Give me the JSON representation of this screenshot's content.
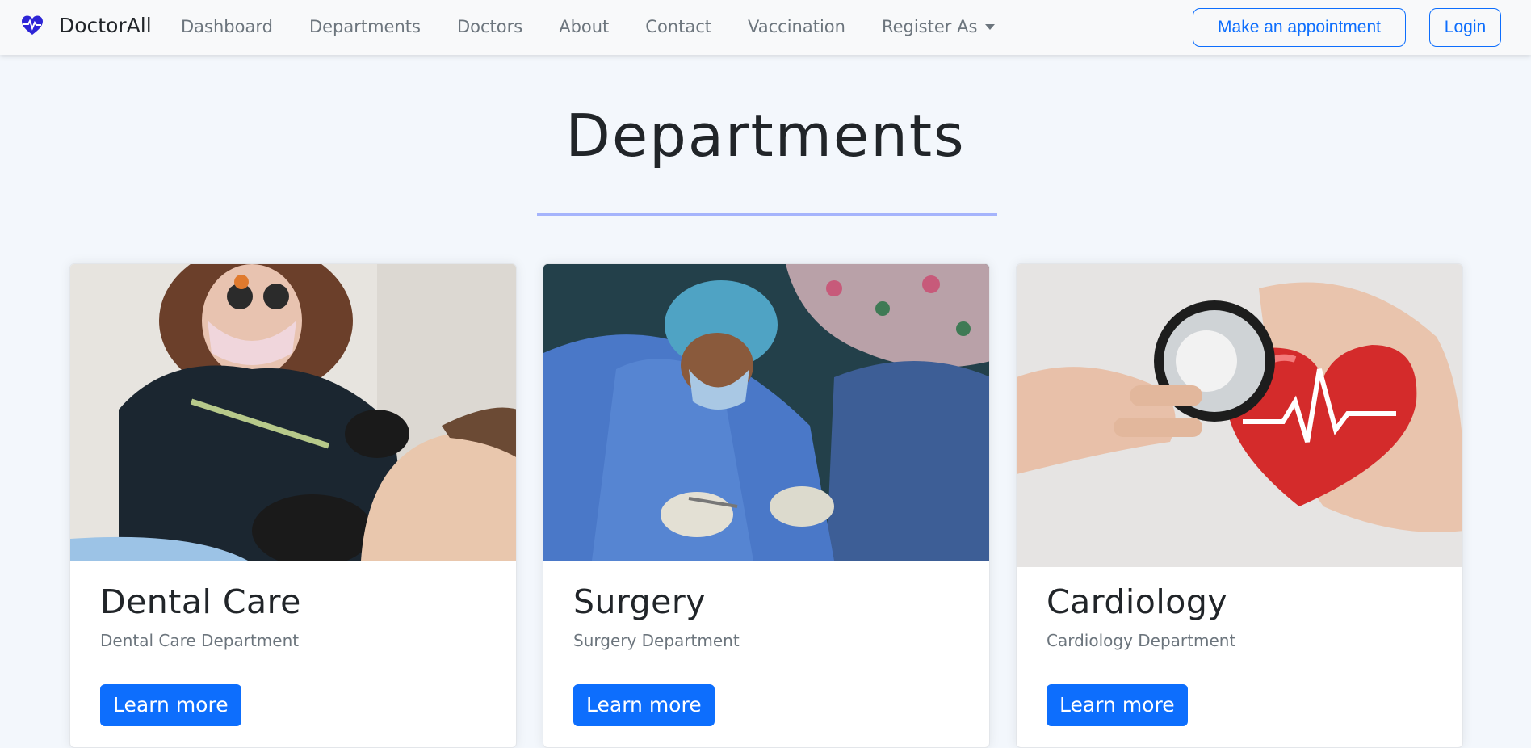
{
  "navbar": {
    "brand": "DoctorAll",
    "brand_icon": "heart-pulse-icon",
    "brand_color": "#2d25d6",
    "links": [
      "Dashboard",
      "Departments",
      "Doctors",
      "About",
      "Contact",
      "Vaccination"
    ],
    "dropdown_label": "Register As",
    "appointment_button": "Make an appointment",
    "login_button": "Login"
  },
  "page": {
    "title": "Departments"
  },
  "departments": [
    {
      "title": "Dental Care",
      "subtitle": "Dental Care Department",
      "button": "Learn more",
      "image": "dentist-treating-patient-photo"
    },
    {
      "title": "Surgery",
      "subtitle": "Surgery Department",
      "button": "Learn more",
      "image": "surgeons-operating-photo"
    },
    {
      "title": "Cardiology",
      "subtitle": "Cardiology Department",
      "button": "Learn more",
      "image": "stethoscope-on-heart-photo"
    }
  ],
  "colors": {
    "primary": "#0d6efd",
    "accent_rule": "#a5b4fc",
    "background": "#f3f7fc"
  }
}
